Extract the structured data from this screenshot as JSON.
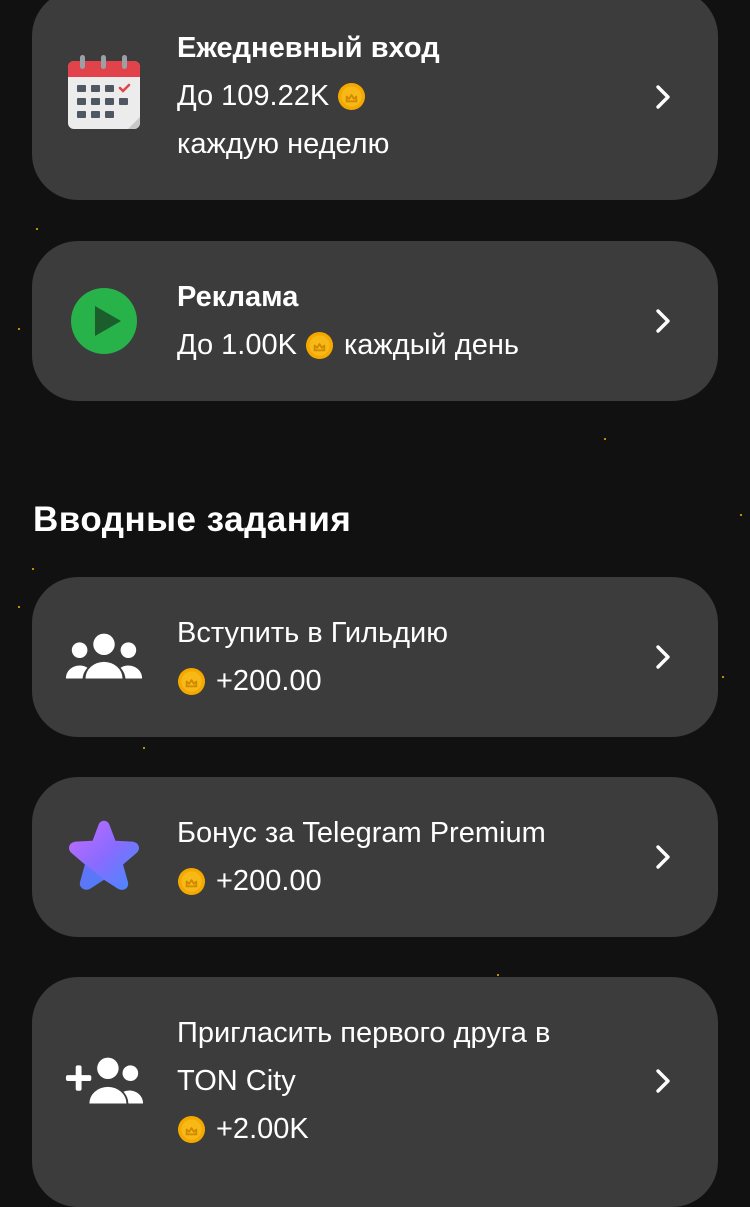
{
  "daily_login": {
    "title": "Ежедневный вход",
    "reward_prefix": "До 109.22K",
    "period": "каждую неделю",
    "icon": "calendar-icon"
  },
  "ads": {
    "title": "Реклама",
    "reward_prefix": "До 1.00K",
    "period": "каждый день",
    "icon": "play-icon"
  },
  "intro_section": {
    "title": "Вводные задания"
  },
  "tasks": [
    {
      "title": "Вступить в Гильдию",
      "reward": "+200.00",
      "icon": "group-icon"
    },
    {
      "title": "Бонус за Telegram Premium",
      "reward": "+200.00",
      "icon": "star-icon"
    },
    {
      "title_line1": "Пригласить первого друга в",
      "title_line2": "TON City",
      "reward": "+2.00K",
      "icon": "add-friend-icon"
    }
  ],
  "colors": {
    "background": "#111111",
    "card": "#3c3c3c",
    "coin": "#f5a800",
    "play_green": "#27b24a"
  }
}
